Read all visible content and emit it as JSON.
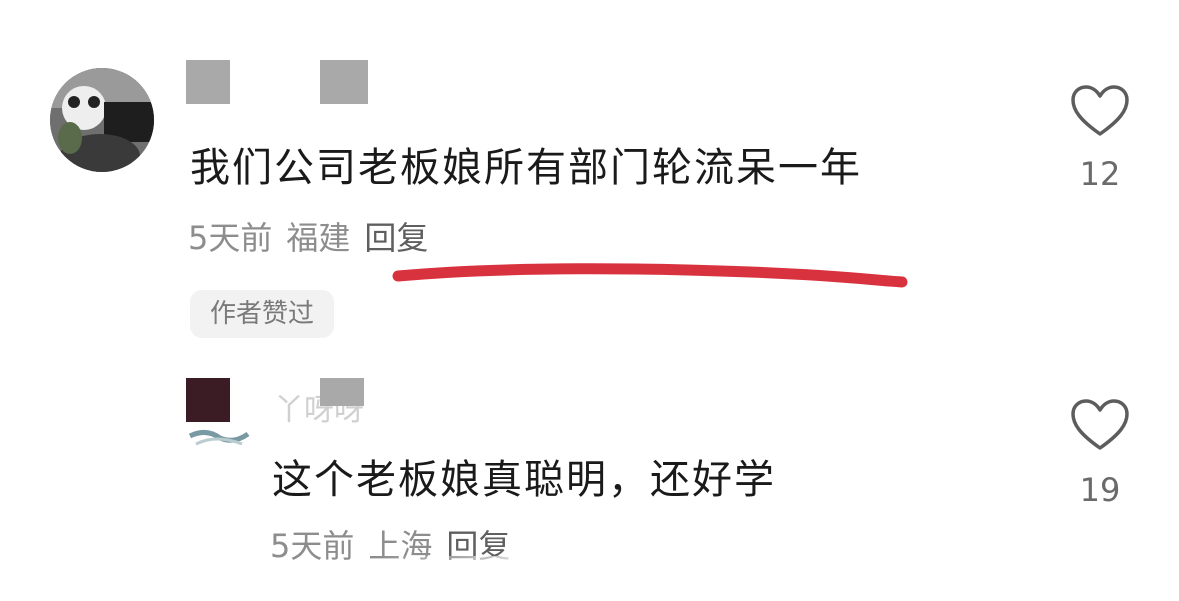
{
  "comments": [
    {
      "text": "我们公司老板娘所有部门轮流呆一年",
      "time": "5天前",
      "location": "福建",
      "reply_label": "回复",
      "badge": "作者赞过",
      "likes": "12"
    },
    {
      "username_partial": "丫呀呀",
      "text": "这个老板娘真聪明，还好学",
      "time": "5天前",
      "location": "上海",
      "reply_label": "回复",
      "likes": "19"
    }
  ],
  "icons": {
    "like": "heart-outline-icon"
  },
  "colors": {
    "annotation_underline": "#d9323f",
    "censor_block": "#a9a9a9"
  }
}
